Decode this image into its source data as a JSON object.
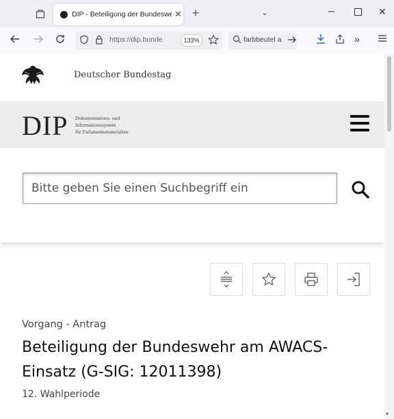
{
  "browser": {
    "tab_title": "DIP - Beteiligung der Bundeswe",
    "tab_close": "✕",
    "new_tab": "+",
    "tabs_dropdown": "⌄",
    "window_minimize": "–",
    "window_close": "✕",
    "url": "https://dip.bunde",
    "zoom": "133%",
    "search_text": "farbbeutel a",
    "icons": [
      "back-icon",
      "forward-icon",
      "reload-icon",
      "shield-icon",
      "lock-icon",
      "bookmark-star-icon",
      "search-icon",
      "arrow-right-icon",
      "download-icon",
      "share-icon",
      "overflow-icon",
      "menu-icon"
    ]
  },
  "header": {
    "org_name": "Deutscher Bundestag",
    "logo": "DIP",
    "logo_subtitle": [
      "Dokumentations- und",
      "Informationssystem",
      "für Parlamentsmaterialien"
    ]
  },
  "search": {
    "placeholder": "Bitte geben Sie einen Suchbegriff ein"
  },
  "toolbar": {
    "buttons": [
      "expand-icon",
      "star-icon",
      "print-icon",
      "export-icon"
    ]
  },
  "document": {
    "type": "Vorgang - Antrag",
    "title": "Beteiligung der Bundeswehr am AWACS-Einsatz (G-SIG: 12011398)",
    "period": "12. Wahlperiode"
  }
}
